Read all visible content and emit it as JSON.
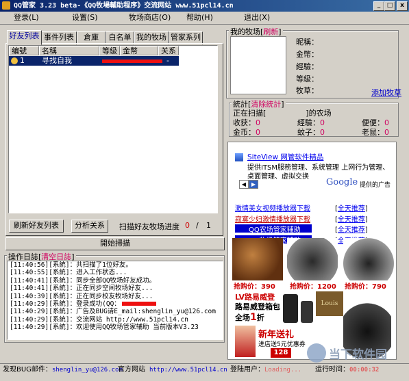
{
  "window": {
    "title": "QQ管家 3.23 beta-《QQ牧場輔助程序》交流网站 www.51pcl14.cn",
    "min_label": "_",
    "max_label": "□",
    "close_label": "x"
  },
  "menu": [
    "登录(L)",
    "设置(S)",
    "牧场商店(O)",
    "帮助(H)",
    "退出(X)"
  ],
  "tabs": [
    "好友列表",
    "事件列表",
    "倉庫",
    "白名单",
    "我的牧场",
    "管家系列"
  ],
  "grid": {
    "columns": [
      "编號",
      "名稱",
      "等級",
      "金幣",
      "关系"
    ],
    "rows": [
      {
        "id": "1",
        "name": "寻找自我",
        "level": "",
        "gold": "",
        "relation": "-"
      }
    ]
  },
  "buttons": {
    "refresh_friends": "刷新好友列表",
    "analyze": "分析关系",
    "start_scan": "開始掃描"
  },
  "scan": {
    "label": "扫描好友牧场进度",
    "current": "0",
    "sep": "/",
    "total": "1"
  },
  "my_ranch": {
    "title": "我的牧场",
    "refresh": "刷新",
    "fields": [
      "昵稱：",
      "金幣：",
      "經驗：",
      "等級：",
      "牧草："
    ],
    "add_grass": "添加牧草"
  },
  "stats": {
    "title": "統計",
    "clear": "清除統計",
    "scanning_prefix": "正在扫描[",
    "scanning_suffix": "]的农场",
    "items": [
      {
        "label": "收获：",
        "value": "0"
      },
      {
        "label": "經驗：",
        "value": "0"
      },
      {
        "label": "便便：",
        "value": "0"
      },
      {
        "label": "金币：",
        "value": "0"
      },
      {
        "label": "蚊子：",
        "value": "0"
      },
      {
        "label": "老鼠：",
        "value": "0"
      }
    ]
  },
  "log": {
    "title": "操作日誌",
    "clear": "清空日誌",
    "lines": [
      "[11:40:56][系統]：共扫描了1位好友。",
      "[11:40:55][系統]：进入工作状态...",
      "[11:40:41][系統]：同步全部QQ牧场好友成功。",
      "[11:40:41][系統]：正在同步空间牧场好友...",
      "[11:40:39][系統]：正在同步校友牧场好友...",
      "[11:40:29][系統]：登录成功(QQ：",
      "[11:40:29][系統]：广告及BUG请E_mail:shenglin_yu@126.com",
      "[11:40:29][系統]：交流网站  http://www.51pcl14.cn",
      "[11:40:29][系統]：欢迎使用QQ牧场管家辅助  当前版本V3.23"
    ]
  },
  "ad": {
    "siteview_title": "SiteView 网管软件精品",
    "siteview_text1": "提供ITSM服務管理、系統管理 上网行为管理、",
    "siteview_text2": "桌面管理、虚拟交换",
    "google_label": "Google",
    "google_suffix": "提供的广告",
    "links": [
      {
        "text": "激情美女视频播放器下载",
        "rec": "全天推荐"
      },
      {
        "text": "寂寞少妇激情播放器下载",
        "rec": "全天推荐"
      },
      {
        "text": "QQ农场管家辅助",
        "rec": "全天推荐"
      },
      {
        "text": "QQ牧场管家辅助",
        "rec": "全天推荐"
      }
    ],
    "prices": [
      "抢购价：390",
      "抢购价：1200",
      "抢购价：790"
    ],
    "lv_text1": "LV路易威登",
    "lv_text2": "路易威登箱包",
    "lv_text3": "全场",
    "lv_text4": "折",
    "lv_num": "1",
    "ny_text1": "新年送礼",
    "ny_text2": "进店送5元优惠券",
    "ny_num": "128",
    "watermark": "当下软件园"
  },
  "status": {
    "bug_label": "发现BUG邮件：",
    "bug_email": "shenglin_yu@126.com",
    "site_label": "官方网站",
    "site_url": "http://www.51pcl14.cn",
    "user_label": "登陆用户：",
    "user_value": "Loading...",
    "time_label": "运行时间：",
    "time_value": "00:00:32"
  },
  "colors": {
    "accent": "#0a246a",
    "link": "#d00060",
    "redact": "#ee1111"
  }
}
